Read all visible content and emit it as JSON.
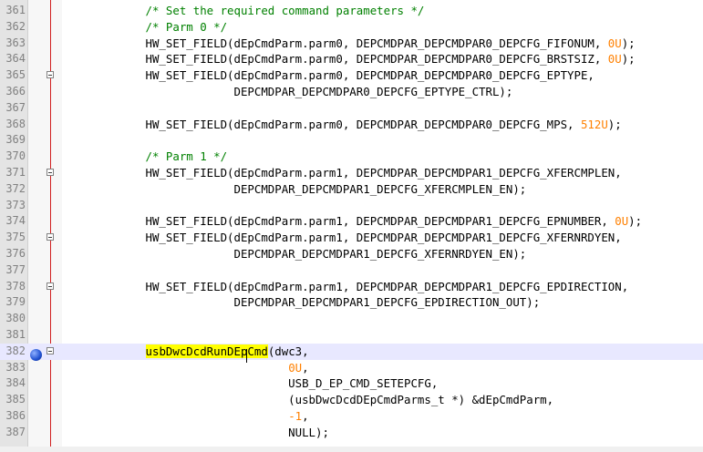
{
  "editor": {
    "bookmark_line": "382",
    "lines": [
      {
        "n": "361",
        "segs": [
          {
            "t": "            "
          },
          {
            "t": "/* Set the required command parameters */",
            "c": "cmt"
          }
        ]
      },
      {
        "n": "362",
        "segs": [
          {
            "t": "            "
          },
          {
            "t": "/* Parm 0 */",
            "c": "cmt"
          }
        ]
      },
      {
        "n": "363",
        "segs": [
          {
            "t": "            HW_SET_FIELD(dEpCmdParm.parm0, DEPCMDPAR_DEPCMDPAR0_DEPCFG_FIFONUM, "
          },
          {
            "t": "0U",
            "c": "num"
          },
          {
            "t": ");"
          }
        ]
      },
      {
        "n": "364",
        "segs": [
          {
            "t": "            HW_SET_FIELD(dEpCmdParm.parm0, DEPCMDPAR_DEPCMDPAR0_DEPCFG_BRSTSIZ, "
          },
          {
            "t": "0U",
            "c": "num"
          },
          {
            "t": ");"
          }
        ]
      },
      {
        "n": "365",
        "fold": true,
        "segs": [
          {
            "t": "            HW_SET_FIELD(dEpCmdParm.parm0, DEPCMDPAR_DEPCMDPAR0_DEPCFG_EPTYPE,"
          }
        ]
      },
      {
        "n": "366",
        "segs": [
          {
            "t": "                         DEPCMDPAR_DEPCMDPAR0_DEPCFG_EPTYPE_CTRL);"
          }
        ]
      },
      {
        "n": "367",
        "segs": [
          {
            "t": ""
          }
        ]
      },
      {
        "n": "368",
        "segs": [
          {
            "t": "            HW_SET_FIELD(dEpCmdParm.parm0, DEPCMDPAR_DEPCMDPAR0_DEPCFG_MPS, "
          },
          {
            "t": "512U",
            "c": "num"
          },
          {
            "t": ");"
          }
        ]
      },
      {
        "n": "369",
        "segs": [
          {
            "t": ""
          }
        ]
      },
      {
        "n": "370",
        "segs": [
          {
            "t": "            "
          },
          {
            "t": "/* Parm 1 */",
            "c": "cmt"
          }
        ]
      },
      {
        "n": "371",
        "fold": true,
        "segs": [
          {
            "t": "            HW_SET_FIELD(dEpCmdParm.parm1, DEPCMDPAR_DEPCMDPAR1_DEPCFG_XFERCMPLEN,"
          }
        ]
      },
      {
        "n": "372",
        "segs": [
          {
            "t": "                         DEPCMDPAR_DEPCMDPAR1_DEPCFG_XFERCMPLEN_EN);"
          }
        ]
      },
      {
        "n": "373",
        "segs": [
          {
            "t": ""
          }
        ]
      },
      {
        "n": "374",
        "segs": [
          {
            "t": "            HW_SET_FIELD(dEpCmdParm.parm1, DEPCMDPAR_DEPCMDPAR1_DEPCFG_EPNUMBER, "
          },
          {
            "t": "0U",
            "c": "num"
          },
          {
            "t": ");"
          }
        ]
      },
      {
        "n": "375",
        "fold": true,
        "segs": [
          {
            "t": "            HW_SET_FIELD(dEpCmdParm.parm1, DEPCMDPAR_DEPCMDPAR1_DEPCFG_XFERNRDYEN,"
          }
        ]
      },
      {
        "n": "376",
        "segs": [
          {
            "t": "                         DEPCMDPAR_DEPCMDPAR1_DEPCFG_XFERNRDYEN_EN);"
          }
        ]
      },
      {
        "n": "377",
        "segs": [
          {
            "t": ""
          }
        ]
      },
      {
        "n": "378",
        "fold": true,
        "segs": [
          {
            "t": "            HW_SET_FIELD(dEpCmdParm.parm1, DEPCMDPAR_DEPCMDPAR1_DEPCFG_EPDIRECTION,"
          }
        ]
      },
      {
        "n": "379",
        "segs": [
          {
            "t": "                         DEPCMDPAR_DEPCMDPAR1_DEPCFG_EPDIRECTION_OUT);"
          }
        ]
      },
      {
        "n": "380",
        "segs": [
          {
            "t": ""
          }
        ]
      },
      {
        "n": "381",
        "segs": [
          {
            "t": ""
          }
        ]
      },
      {
        "n": "382",
        "fold": true,
        "current": true,
        "segs": [
          {
            "t": "            "
          },
          {
            "t": "usbDwcDcdRunDEpCmd",
            "c": "hl"
          },
          {
            "t": "(dwc3,"
          }
        ]
      },
      {
        "n": "383",
        "segs": [
          {
            "t": "                                 "
          },
          {
            "t": "0U",
            "c": "num"
          },
          {
            "t": ","
          }
        ]
      },
      {
        "n": "384",
        "segs": [
          {
            "t": "                                 USB_D_EP_CMD_SETEPCFG,"
          }
        ]
      },
      {
        "n": "385",
        "segs": [
          {
            "t": "                                 (usbDwcDcdDEpCmdParms_t *) &dEpCmdParm,"
          }
        ]
      },
      {
        "n": "386",
        "segs": [
          {
            "t": "                                 "
          },
          {
            "t": "-1",
            "c": "num"
          },
          {
            "t": ","
          }
        ]
      },
      {
        "n": "387",
        "segs": [
          {
            "t": "                                 NULL);"
          }
        ]
      }
    ]
  }
}
